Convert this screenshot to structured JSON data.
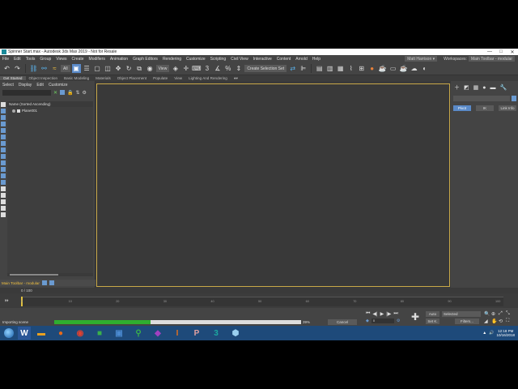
{
  "window": {
    "title": "Spinner Start.max - Autodesk 3ds Max 2019 - Not for Resale",
    "minimize": "—",
    "maximize": "□",
    "close": "✕"
  },
  "menubar": {
    "items": [
      "File",
      "Edit",
      "Tools",
      "Group",
      "Views",
      "Create",
      "Modifiers",
      "Animation",
      "Graph Editors",
      "Rendering",
      "Customize",
      "Scripting",
      "Civil View",
      "Interactive",
      "Content",
      "Arnold",
      "Help"
    ],
    "user": "Matt Harrison ▾",
    "workspaces_label": "Workspaces:",
    "workspace_value": "Main Toolbar - modular"
  },
  "toolbar": {
    "selection_filter": "All",
    "view_dropdown": "View",
    "named_selection": "Create Selection Set"
  },
  "ribbon": {
    "tabs": [
      "Get Started",
      "Object Inspection",
      "Basic Modeling",
      "Materials",
      "Object Placement",
      "Populate",
      "View",
      "Lighting And Rendering"
    ]
  },
  "explorer": {
    "tabs": [
      "Select",
      "Display",
      "Edit",
      "Customize"
    ],
    "header": "Name (Sorted Ascending)",
    "rows": [
      {
        "name": "Plane001"
      }
    ],
    "footer_label": "Main Toolbar - modular"
  },
  "command_panel": {
    "buttons": [
      "Pivot",
      "IK",
      "Link Info"
    ]
  },
  "timeline": {
    "frame_display": "0 / 100",
    "ticks": [
      "0",
      "10",
      "20",
      "30",
      "40",
      "50",
      "60",
      "70",
      "80",
      "90",
      "100"
    ]
  },
  "status": {
    "message": "Importing scene",
    "progress_percent": "39%",
    "progress_value": 0.39,
    "cancel_label": "Cancel",
    "auto_label": "Auto",
    "selected_label": "Selected",
    "setk_label": "Set K.",
    "filters_label": "Filters...",
    "frame_field": "0"
  },
  "taskbar": {
    "time": "12:18 PM",
    "date": "10/16/2018"
  },
  "colors": {
    "progress": "#2fae2f",
    "viewport_border": "#c8a848",
    "accent": "#5a8ac8"
  }
}
